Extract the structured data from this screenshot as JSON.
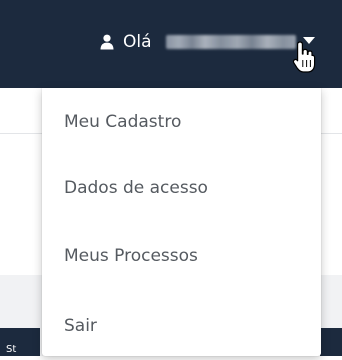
{
  "header": {
    "greeting": "Olá",
    "user_name": "",
    "background_color": "#1c2a3e"
  },
  "icons": {
    "user": "user-icon",
    "caret": "caret-down-icon",
    "cursor": "hand-pointer-icon"
  },
  "dropdown": {
    "items": [
      {
        "label": "Meu Cadastro"
      },
      {
        "label": "Dados de acesso"
      },
      {
        "label": "Meus Processos"
      },
      {
        "label": "Sair"
      }
    ]
  },
  "page": {
    "hint_text": "St"
  }
}
